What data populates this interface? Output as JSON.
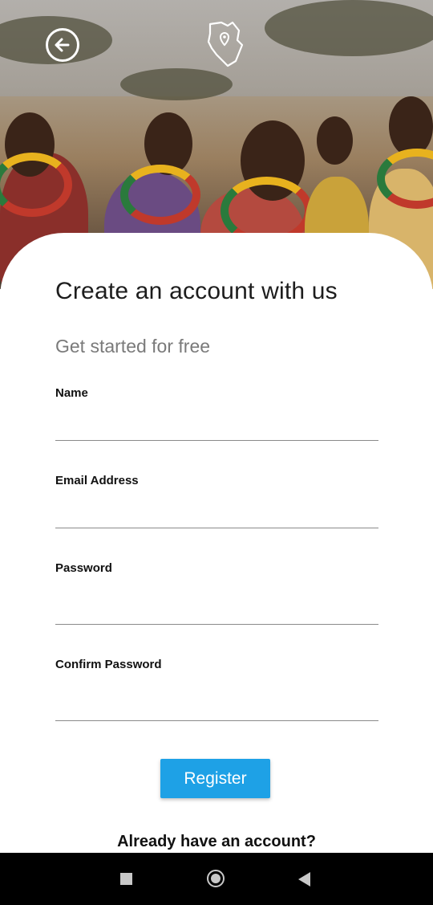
{
  "header": {
    "back_icon": "arrow-left-circle-icon",
    "logo_icon": "kenya-map-pin-icon"
  },
  "form": {
    "title": "Create an account with us",
    "subtitle": "Get started for free",
    "fields": [
      {
        "label": "Name",
        "value": "",
        "type": "text"
      },
      {
        "label": "Email Address",
        "value": "",
        "type": "email"
      },
      {
        "label": "Password",
        "value": "",
        "type": "password"
      },
      {
        "label": "Confirm Password",
        "value": "",
        "type": "password"
      }
    ],
    "register_label": "Register",
    "login_prompt": "Already have an account?"
  },
  "colors": {
    "accent": "#1ea1e6",
    "text": "#1d1d1d",
    "muted": "#7a7a7a"
  },
  "system_nav": {
    "icons": [
      "recents-square-icon",
      "home-circle-icon",
      "back-triangle-icon"
    ]
  }
}
